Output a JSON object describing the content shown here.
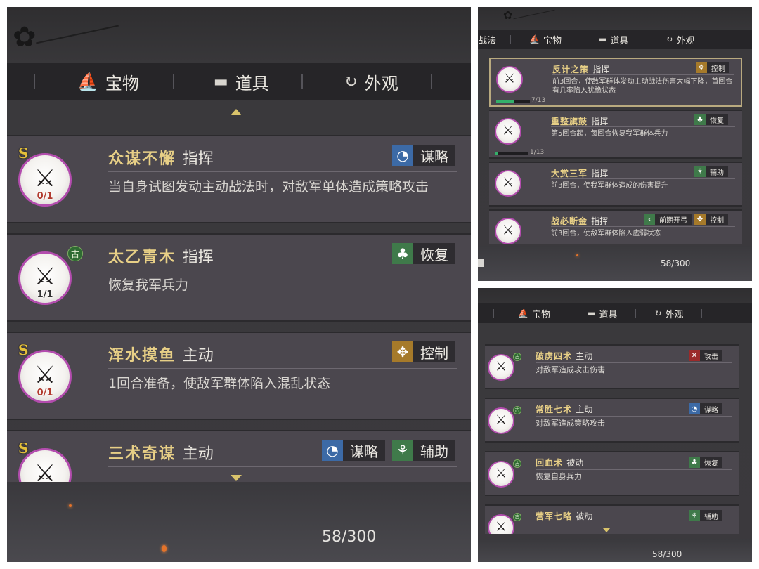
{
  "tabs_left": [
    {
      "icon": "treasure-icon",
      "label": "宝物"
    },
    {
      "icon": "item-icon",
      "label": "道具"
    },
    {
      "icon": "appearance-icon",
      "label": "外观"
    }
  ],
  "tabs_right": [
    {
      "icon": "",
      "label": "战法"
    },
    {
      "icon": "treasure-icon",
      "label": "宝物"
    },
    {
      "icon": "item-icon",
      "label": "道具"
    },
    {
      "icon": "appearance-icon",
      "label": "外观"
    }
  ],
  "panel_left": {
    "cards": [
      {
        "rank": "S",
        "count": "0/1",
        "name": "众谋不懈",
        "type": "指挥",
        "desc": "当自身试图发动主动战法时，对敌军单体造成策略攻击",
        "tags": [
          {
            "label": "谋略",
            "color": "#3c6aa6"
          }
        ]
      },
      {
        "rank": "",
        "ancient": "古",
        "count": "1/1",
        "name": "太乙青木",
        "type": "指挥",
        "desc": "恢复我军兵力",
        "tags": [
          {
            "label": "恢复",
            "color": "#3f7a4a"
          }
        ]
      },
      {
        "rank": "S",
        "count": "0/1",
        "name": "浑水摸鱼",
        "type": "主动",
        "desc": "1回合准备，使敌军群体陷入混乱状态",
        "tags": [
          {
            "label": "控制",
            "color": "#a67a2a"
          }
        ]
      },
      {
        "rank": "S",
        "count": "",
        "name": "三术奇谋",
        "type": "主动",
        "desc": "",
        "tags": [
          {
            "label": "谋略",
            "color": "#3c6aa6"
          },
          {
            "label": "辅助",
            "color": "#3f7a4a"
          }
        ]
      }
    ],
    "count": "58/300"
  },
  "panel_top_right": {
    "cards": [
      {
        "name": "反计之策",
        "type": "指挥",
        "desc": "前3回合，使敌军群体发动主动战法伤害大幅下降，首回合有几率陷入犹豫状态",
        "tags": [
          {
            "label": "控制",
            "color": "#a67a2a"
          }
        ],
        "progress": "7/13",
        "fill": 0.54
      },
      {
        "name": "重整旗鼓",
        "type": "指挥",
        "desc": "第5回合起，每回合恢复我军群体兵力",
        "tags": [
          {
            "label": "恢复",
            "color": "#3f7a4a"
          }
        ],
        "progress": "1/13",
        "fill": 0.08
      },
      {
        "name": "大赏三军",
        "type": "指挥",
        "desc": "前3回合，使我军群体造成的伤害提升",
        "tags": [
          {
            "label": "辅助",
            "color": "#3f7a4a"
          }
        ],
        "progress": "",
        "fill": 0
      },
      {
        "name": "战必断金",
        "type": "指挥",
        "desc": "前3回合，使敌军群体陷入虚弱状态",
        "tags": [
          {
            "label": "前期开弓",
            "color": "#3f7a4a"
          },
          {
            "label": "控制",
            "color": "#a67a2a"
          }
        ],
        "progress": "",
        "fill": 0
      }
    ],
    "count": "58/300"
  },
  "panel_bottom_right": {
    "cards": [
      {
        "name": "破虏四术",
        "type": "主动",
        "desc": "对敌军造成攻击伤害",
        "tags": [
          {
            "label": "攻击",
            "color": "#9b2a2a"
          }
        ]
      },
      {
        "name": "常胜七术",
        "type": "主动",
        "desc": "对敌军造成策略攻击",
        "tags": [
          {
            "label": "谋略",
            "color": "#3c6aa6"
          }
        ]
      },
      {
        "name": "回血术",
        "type": "被动",
        "desc": "恢复自身兵力",
        "tags": [
          {
            "label": "恢复",
            "color": "#3f7a4a"
          }
        ]
      },
      {
        "name": "营军七略",
        "type": "被动",
        "desc": "",
        "tags": [
          {
            "label": "辅助",
            "color": "#3f7a4a"
          }
        ]
      }
    ],
    "count": "58/300"
  }
}
